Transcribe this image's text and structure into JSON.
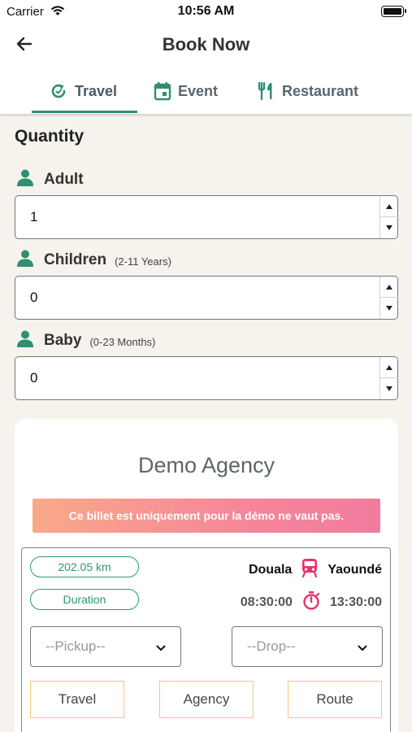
{
  "status_bar": {
    "carrier": "Carrier",
    "time": "10:56 AM"
  },
  "header": {
    "title": "Book Now"
  },
  "tabs": [
    {
      "label": "Travel",
      "icon": "refresh-arrow-icon",
      "active": true
    },
    {
      "label": "Event",
      "icon": "calendar-icon",
      "active": false
    },
    {
      "label": "Restaurant",
      "icon": "fork-knife-icon",
      "active": false
    }
  ],
  "quantity": {
    "title": "Quantity",
    "adult": {
      "label": "Adult",
      "hint": "",
      "value": "1"
    },
    "children": {
      "label": "Children",
      "hint": "(2-11 Years)",
      "value": "0"
    },
    "baby": {
      "label": "Baby",
      "hint": "(0-23 Months)",
      "value": "0"
    }
  },
  "card": {
    "agency_name": "Demo Agency",
    "demo_notice": "Ce billet est uniquement pour la démo ne vaut pas.",
    "distance": "202.05 km",
    "duration_label": "Duration",
    "from": "Douala",
    "to": "Yaoundé",
    "depart_time": "08:30:00",
    "arrive_time": "13:30:00",
    "pickup_placeholder": "--Pickup--",
    "drop_placeholder": "--Drop--",
    "buttons": {
      "travel": "Travel",
      "agency": "Agency",
      "route": "Route"
    }
  },
  "colors": {
    "accent": "#2f8f72",
    "pill_green": "#2f9a6b",
    "bus_pink": "#e8336b",
    "banner_start": "#f9a98a",
    "banner_end": "#f27c9e",
    "button_border": "#f4c77a"
  }
}
